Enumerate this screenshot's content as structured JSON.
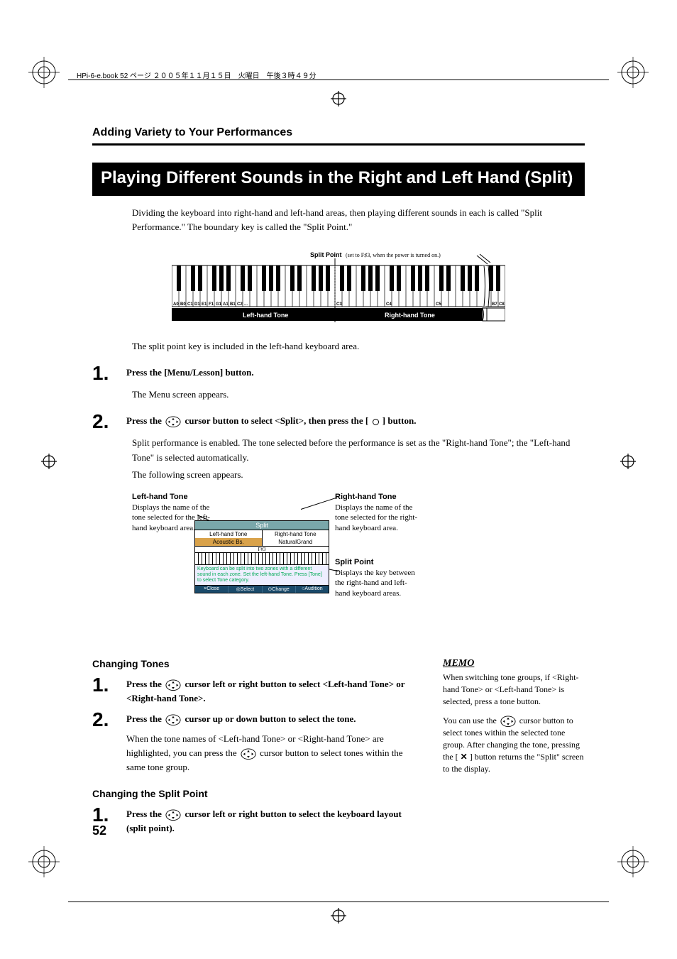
{
  "header_note": "HPi-6-e.book  52 ページ  ２００５年１１月１５日　火曜日　午後３時４９分",
  "section_header": "Adding Variety to Your Performances",
  "title": "Playing Different Sounds in the Right and Left Hand (Split)",
  "intro": "Dividing the keyboard into right-hand and left-hand areas, then playing different sounds in each is called \"Split Performance.\" The boundary key is called the \"Split Point.\"",
  "split_label_prefix": "Split Point",
  "split_label_rest": " (set to F♯3, when the power is turned on.)",
  "key_labels_left": [
    "A0",
    "B0",
    "C1",
    "D1",
    "E1",
    "F1",
    "G1",
    "A1",
    "B1",
    "C2",
    "..."
  ],
  "key_labels_mid": [
    "C3",
    "C4",
    "C5"
  ],
  "key_labels_right": [
    "B7",
    "C8"
  ],
  "left_tone_label": "Left-hand Tone",
  "right_tone_label": "Right-hand Tone",
  "after_kb": "The split point key is included in the left-hand keyboard area.",
  "step1": {
    "num": "1.",
    "bold": "Press the [Menu/Lesson] button.",
    "after": "The Menu screen appears."
  },
  "step2": {
    "num": "2.",
    "b1": "Press the ",
    "b2": " cursor button to select <Split>, then press the [ ",
    "b3": " ] button.",
    "after1": "Split performance is enabled. The tone selected before the performance is set as the \"Right-hand Tone\"; the \"Left-hand Tone\" is selected automatically.",
    "after2": "The following screen appears."
  },
  "callout_left": {
    "h": "Left-hand Tone",
    "t": "Displays the name of the tone selected for the left-hand keyboard area."
  },
  "callout_right1": {
    "h": "Right-hand Tone",
    "t": "Displays the name of the tone selected for the right-hand keyboard area."
  },
  "callout_right2": {
    "h": "Split Point",
    "t": "Displays the key between the right-hand and left-hand keyboard areas."
  },
  "lcd": {
    "title": "Split",
    "hdr_l": "Left-hand Tone",
    "hdr_r": "Right-hand Tone",
    "val_l": "Acoustic Bs.",
    "val_r": "NaturalGrand",
    "sp": "F#3",
    "msg": "Keyboard can be split into two zones with a different sound in each zone. Set the left-hand Tone. Press [Tone] to select Tone category.",
    "bb": [
      "×Close",
      "◎Select",
      "⊙Change",
      "○Audition"
    ]
  },
  "changing_tones_h": "Changing Tones",
  "ct_step1": {
    "num": "1.",
    "b1": "Press the ",
    "b2": " cursor left or right button to select <Left-hand Tone> or <Right-hand Tone>."
  },
  "ct_step2": {
    "num": "2.",
    "b1": "Press the ",
    "b2": " cursor up or down button to select the tone.",
    "after_a": "When the tone names of <Left-hand Tone> or <Right-hand Tone> are highlighted, you can press the ",
    "after_b": " cursor button to select tones within the same tone group."
  },
  "changing_sp_h": "Changing the Split Point",
  "csp_step1": {
    "num": "1.",
    "b1": "Press the ",
    "b2": " cursor left or right button to select the keyboard layout (split point)."
  },
  "memo_label": "MEMO",
  "memo_p1": "When switching tone groups, if <Right-hand Tone> or <Left-hand Tone> is selected, press a tone button.",
  "memo_p2a": "You can use the ",
  "memo_p2b": " cursor button to select tones within the selected tone group. After changing the tone, pressing the [ ",
  "memo_p2c": " ] button returns the \"Split\" screen to the display.",
  "page_number": "52"
}
